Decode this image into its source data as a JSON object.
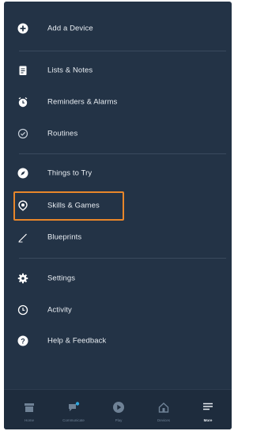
{
  "menu": {
    "add_device": "Add a Device",
    "lists_notes": "Lists & Notes",
    "reminders_alarms": "Reminders & Alarms",
    "routines": "Routines",
    "things_to_try": "Things to Try",
    "skills_games": "Skills & Games",
    "blueprints": "Blueprints",
    "settings": "Settings",
    "activity": "Activity",
    "help_feedback": "Help & Feedback"
  },
  "tabs": [
    {
      "label": "Home",
      "icon": "home-icon"
    },
    {
      "label": "Communicate",
      "icon": "communicate-icon"
    },
    {
      "label": "Play",
      "icon": "play-icon"
    },
    {
      "label": "Devices",
      "icon": "devices-icon"
    },
    {
      "label": "More",
      "icon": "more-icon"
    }
  ],
  "colors": {
    "background": "#233346",
    "highlight": "#e8862a",
    "text": "#e8edf2"
  }
}
